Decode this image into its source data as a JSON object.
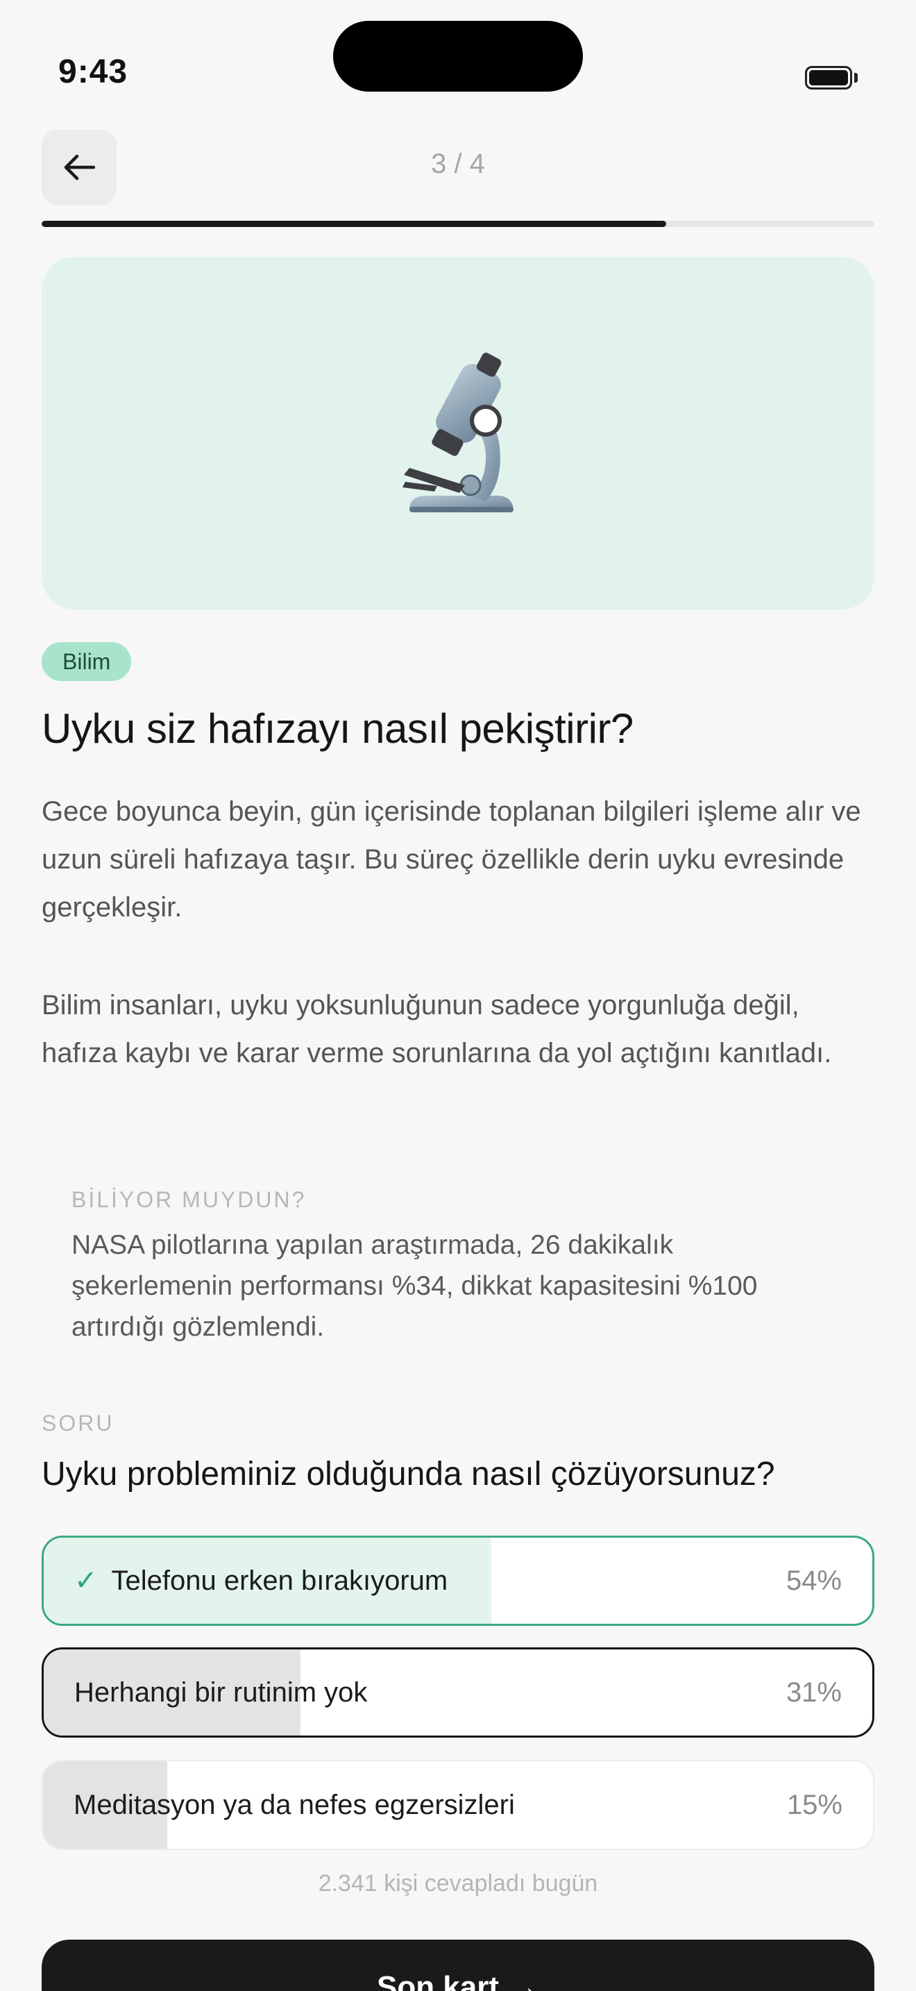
{
  "status_bar": {
    "time": "9:43"
  },
  "header": {
    "step": "3 / 4",
    "progress": 0.75
  },
  "hero": {
    "icon": "microscope-icon",
    "background": "#e1f3ec"
  },
  "article": {
    "category": "Bilim",
    "title": "Uyku siz hafızayı nasıl pekiştirir?",
    "paragraphs": [
      "Gece boyunca beyin, gün içerisinde toplanan bilgileri işleme alır ve uzun süreli hafızaya taşır. Bu süreç özellikle derin uyku evresinde gerçekleşir.",
      "Bilim insanları, uyku yoksunluğunun sadece yorgunluğa değil, hafıza kaybı ve karar verme sorunlarına da yol açtığını kanıtladı."
    ],
    "fact_label": "BİLİYOR MUYDUN?",
    "fact_text": "NASA pilotlarına yapılan araştırmada, 26 dakikalık şekerlemenin performansı %34, dikkat kapasitesini %100 artırdığı gözlemlendi."
  },
  "poll": {
    "label": "SORU",
    "question": "Uyku probleminiz olduğunda nasıl çözüyorsunuz?",
    "options": [
      {
        "label": "Telefonu erken bırakıyorum",
        "percent": "54%",
        "fraction": 0.54,
        "selected": true
      },
      {
        "label": "Herhangi bir rutinim yok",
        "percent": "31%",
        "fraction": 0.31,
        "selected": false
      },
      {
        "label": "Meditasyon ya da nefes egzersizleri",
        "percent": "15%",
        "fraction": 0.15,
        "selected": false
      }
    ],
    "responses": "2.341 kişi cevapladı bugün"
  },
  "footer": {
    "next_label": "Son kart"
  },
  "colors": {
    "accent": "#3aa97f",
    "badge": "#a8e4cc",
    "dark": "#1a1a1a"
  }
}
